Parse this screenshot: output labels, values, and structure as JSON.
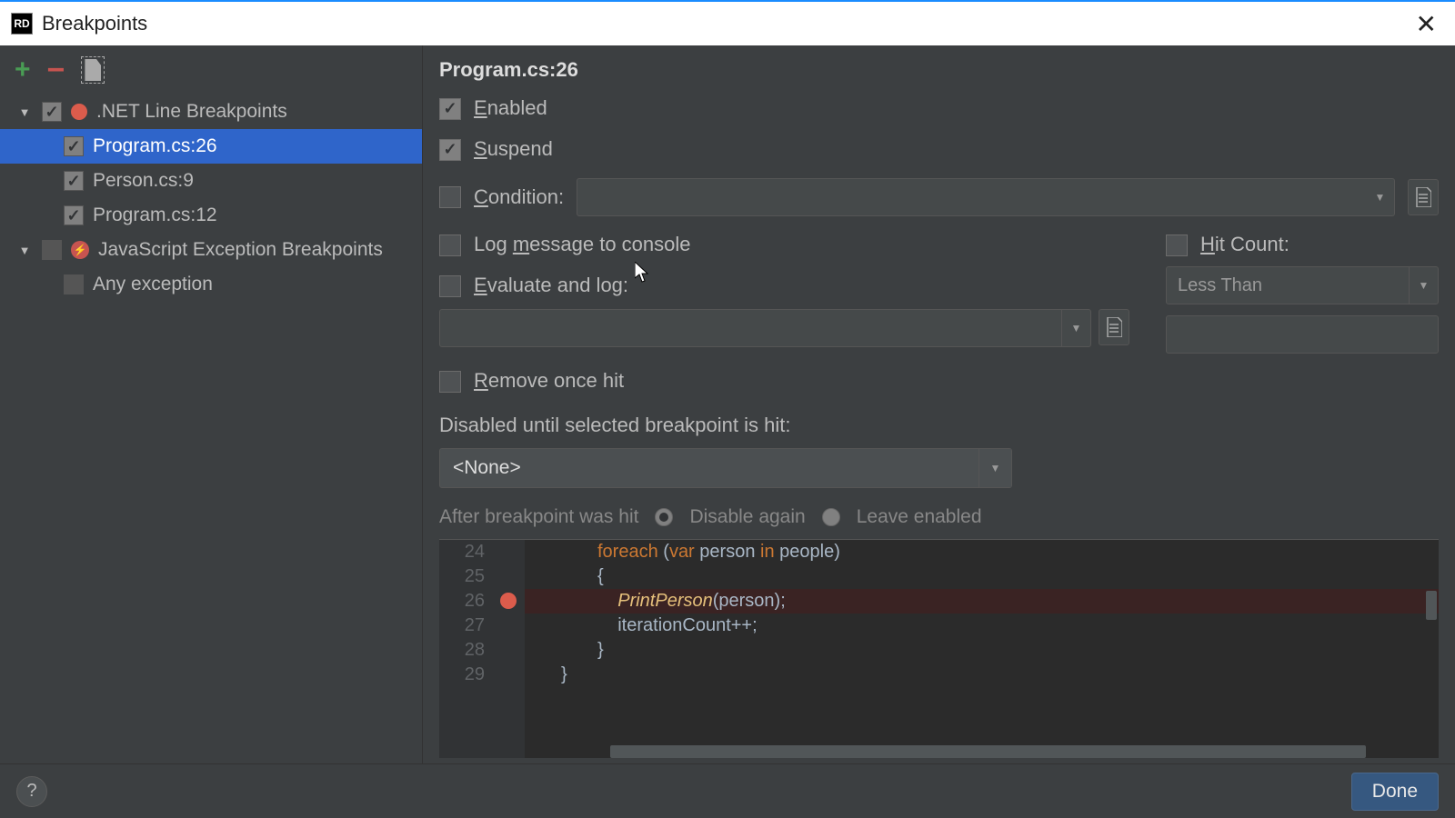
{
  "titlebar": {
    "title": "Breakpoints"
  },
  "toolbar": {
    "add": "+",
    "remove": "−"
  },
  "tree": {
    "group1": {
      "label": ".NET Line Breakpoints"
    },
    "item1": {
      "label": "Program.cs:26"
    },
    "item2": {
      "label": "Person.cs:9"
    },
    "item3": {
      "label": "Program.cs:12"
    },
    "group2": {
      "label": "JavaScript Exception Breakpoints"
    },
    "item4": {
      "label": "Any exception"
    }
  },
  "details": {
    "title": "Program.cs:26",
    "enabled_label": "Enabled",
    "suspend_label": "Suspend",
    "condition_label": "Condition:",
    "log_label": "Log message to console",
    "hitcount_label": "Hit Count:",
    "evaluate_label": "Evaluate and log:",
    "hitcount_mode": "Less Than",
    "remove_label": "Remove once hit",
    "disabled_until_label": "Disabled until selected breakpoint is hit:",
    "disabled_until_value": "<None>",
    "after_hit_label": "After breakpoint was hit",
    "radio_disable": "Disable again",
    "radio_leave": "Leave enabled"
  },
  "code": {
    "lines": {
      "24": {
        "num": "24"
      },
      "25": {
        "num": "25"
      },
      "26": {
        "num": "26"
      },
      "27": {
        "num": "27"
      },
      "28": {
        "num": "28"
      },
      "29": {
        "num": "29"
      }
    },
    "l24_foreach": "foreach",
    "l24_open": " (",
    "l24_var": "var",
    "l24_person": " person ",
    "l24_in": "in",
    "l24_close": " people)",
    "l25": "{",
    "l26_fn": "PrintPerson",
    "l26_args": "(person);",
    "l27": "iterationCount++;",
    "l28": "}",
    "l29": "}"
  },
  "bottom": {
    "help": "?",
    "done": "Done"
  }
}
